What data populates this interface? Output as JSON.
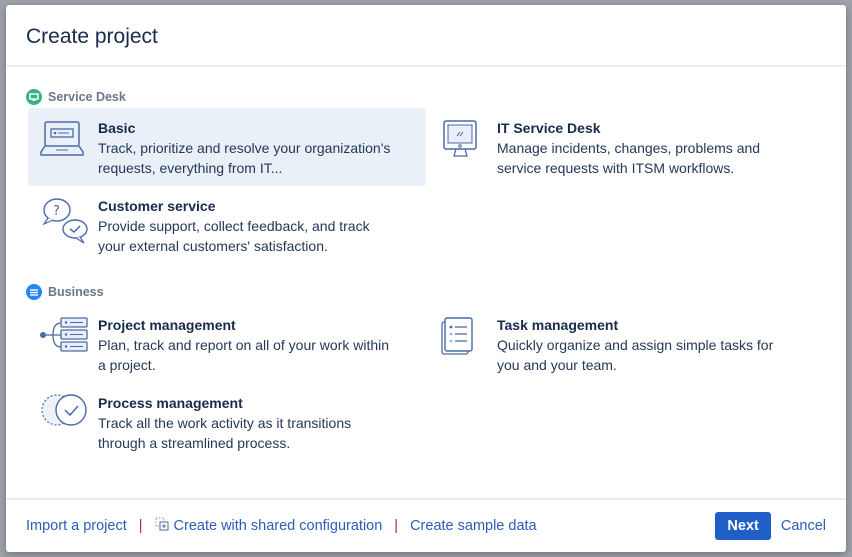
{
  "dialog": {
    "title": "Create project"
  },
  "sections": [
    {
      "label": "Service Desk",
      "color": "#36b37e",
      "items": [
        {
          "title": "Basic",
          "desc": "Track, prioritize and resolve your organization's requests, everything from IT...",
          "icon": "laptop-icon",
          "selected": true
        },
        {
          "title": "IT Service Desk",
          "desc": "Manage incidents, changes, problems and service requests with ITSM workflows.",
          "icon": "monitor-icon"
        },
        {
          "title": "Customer service",
          "desc": "Provide support, collect feedback, and track your external customers' satisfaction.",
          "icon": "chat-bubbles-icon"
        }
      ]
    },
    {
      "label": "Business",
      "color": "#2684ff",
      "items": [
        {
          "title": "Project management",
          "desc": "Plan, track and report on all of your work within a project.",
          "icon": "hierarchy-list-icon"
        },
        {
          "title": "Task management",
          "desc": "Quickly organize and assign simple tasks for you and your team.",
          "icon": "checklist-icon"
        },
        {
          "title": "Process management",
          "desc": "Track all the work activity as it transitions through a streamlined process.",
          "icon": "process-check-icon"
        }
      ]
    }
  ],
  "footer": {
    "import": "Import a project",
    "shared": "Create with shared configuration",
    "sample": "Create sample data",
    "next": "Next",
    "cancel": "Cancel"
  }
}
